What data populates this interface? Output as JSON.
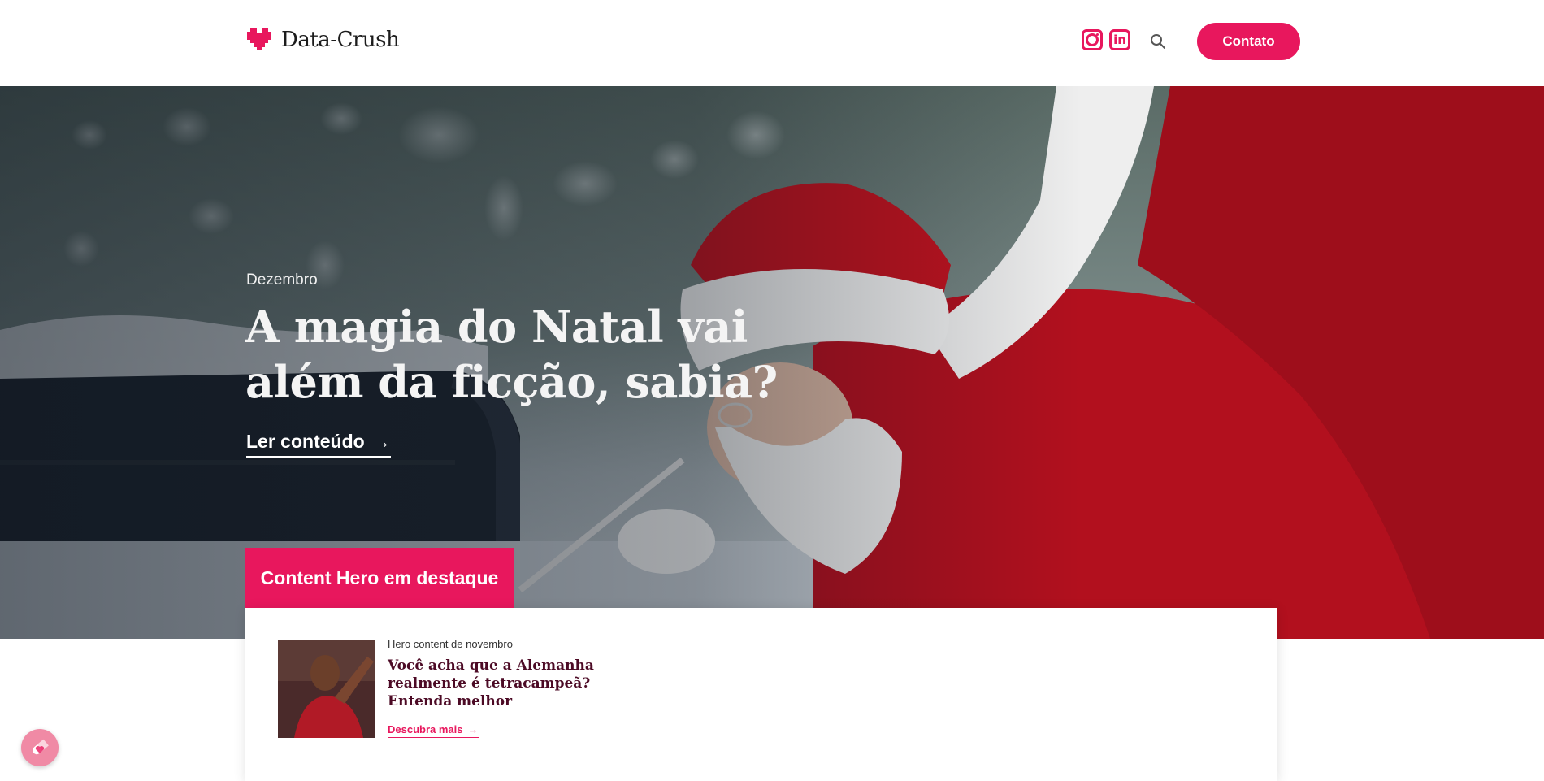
{
  "brand": {
    "name": "Data-Crush",
    "accent": "#e8175d"
  },
  "header": {
    "social": [
      {
        "icon": "instagram-icon"
      },
      {
        "icon": "linkedin-icon",
        "glyph": "in"
      }
    ],
    "search_icon": "search-icon",
    "contact_label": "Contato"
  },
  "hero": {
    "label": "Dezembro",
    "title": "A magia do Natal vai além da ficção, sabia?",
    "link_label": "Ler conteúdo",
    "link_icon": "arrow-right-icon"
  },
  "featured": {
    "tab_label": "Content Hero em destaque",
    "card": {
      "overline": "Hero content de novembro",
      "title": "Você acha que a Alemanha realmente é tetracampeã? Entenda melhor",
      "link_label": "Descubra mais",
      "link_icon": "arrow-right-icon"
    }
  },
  "float_button": {
    "icon": "pill-heart-icon"
  }
}
